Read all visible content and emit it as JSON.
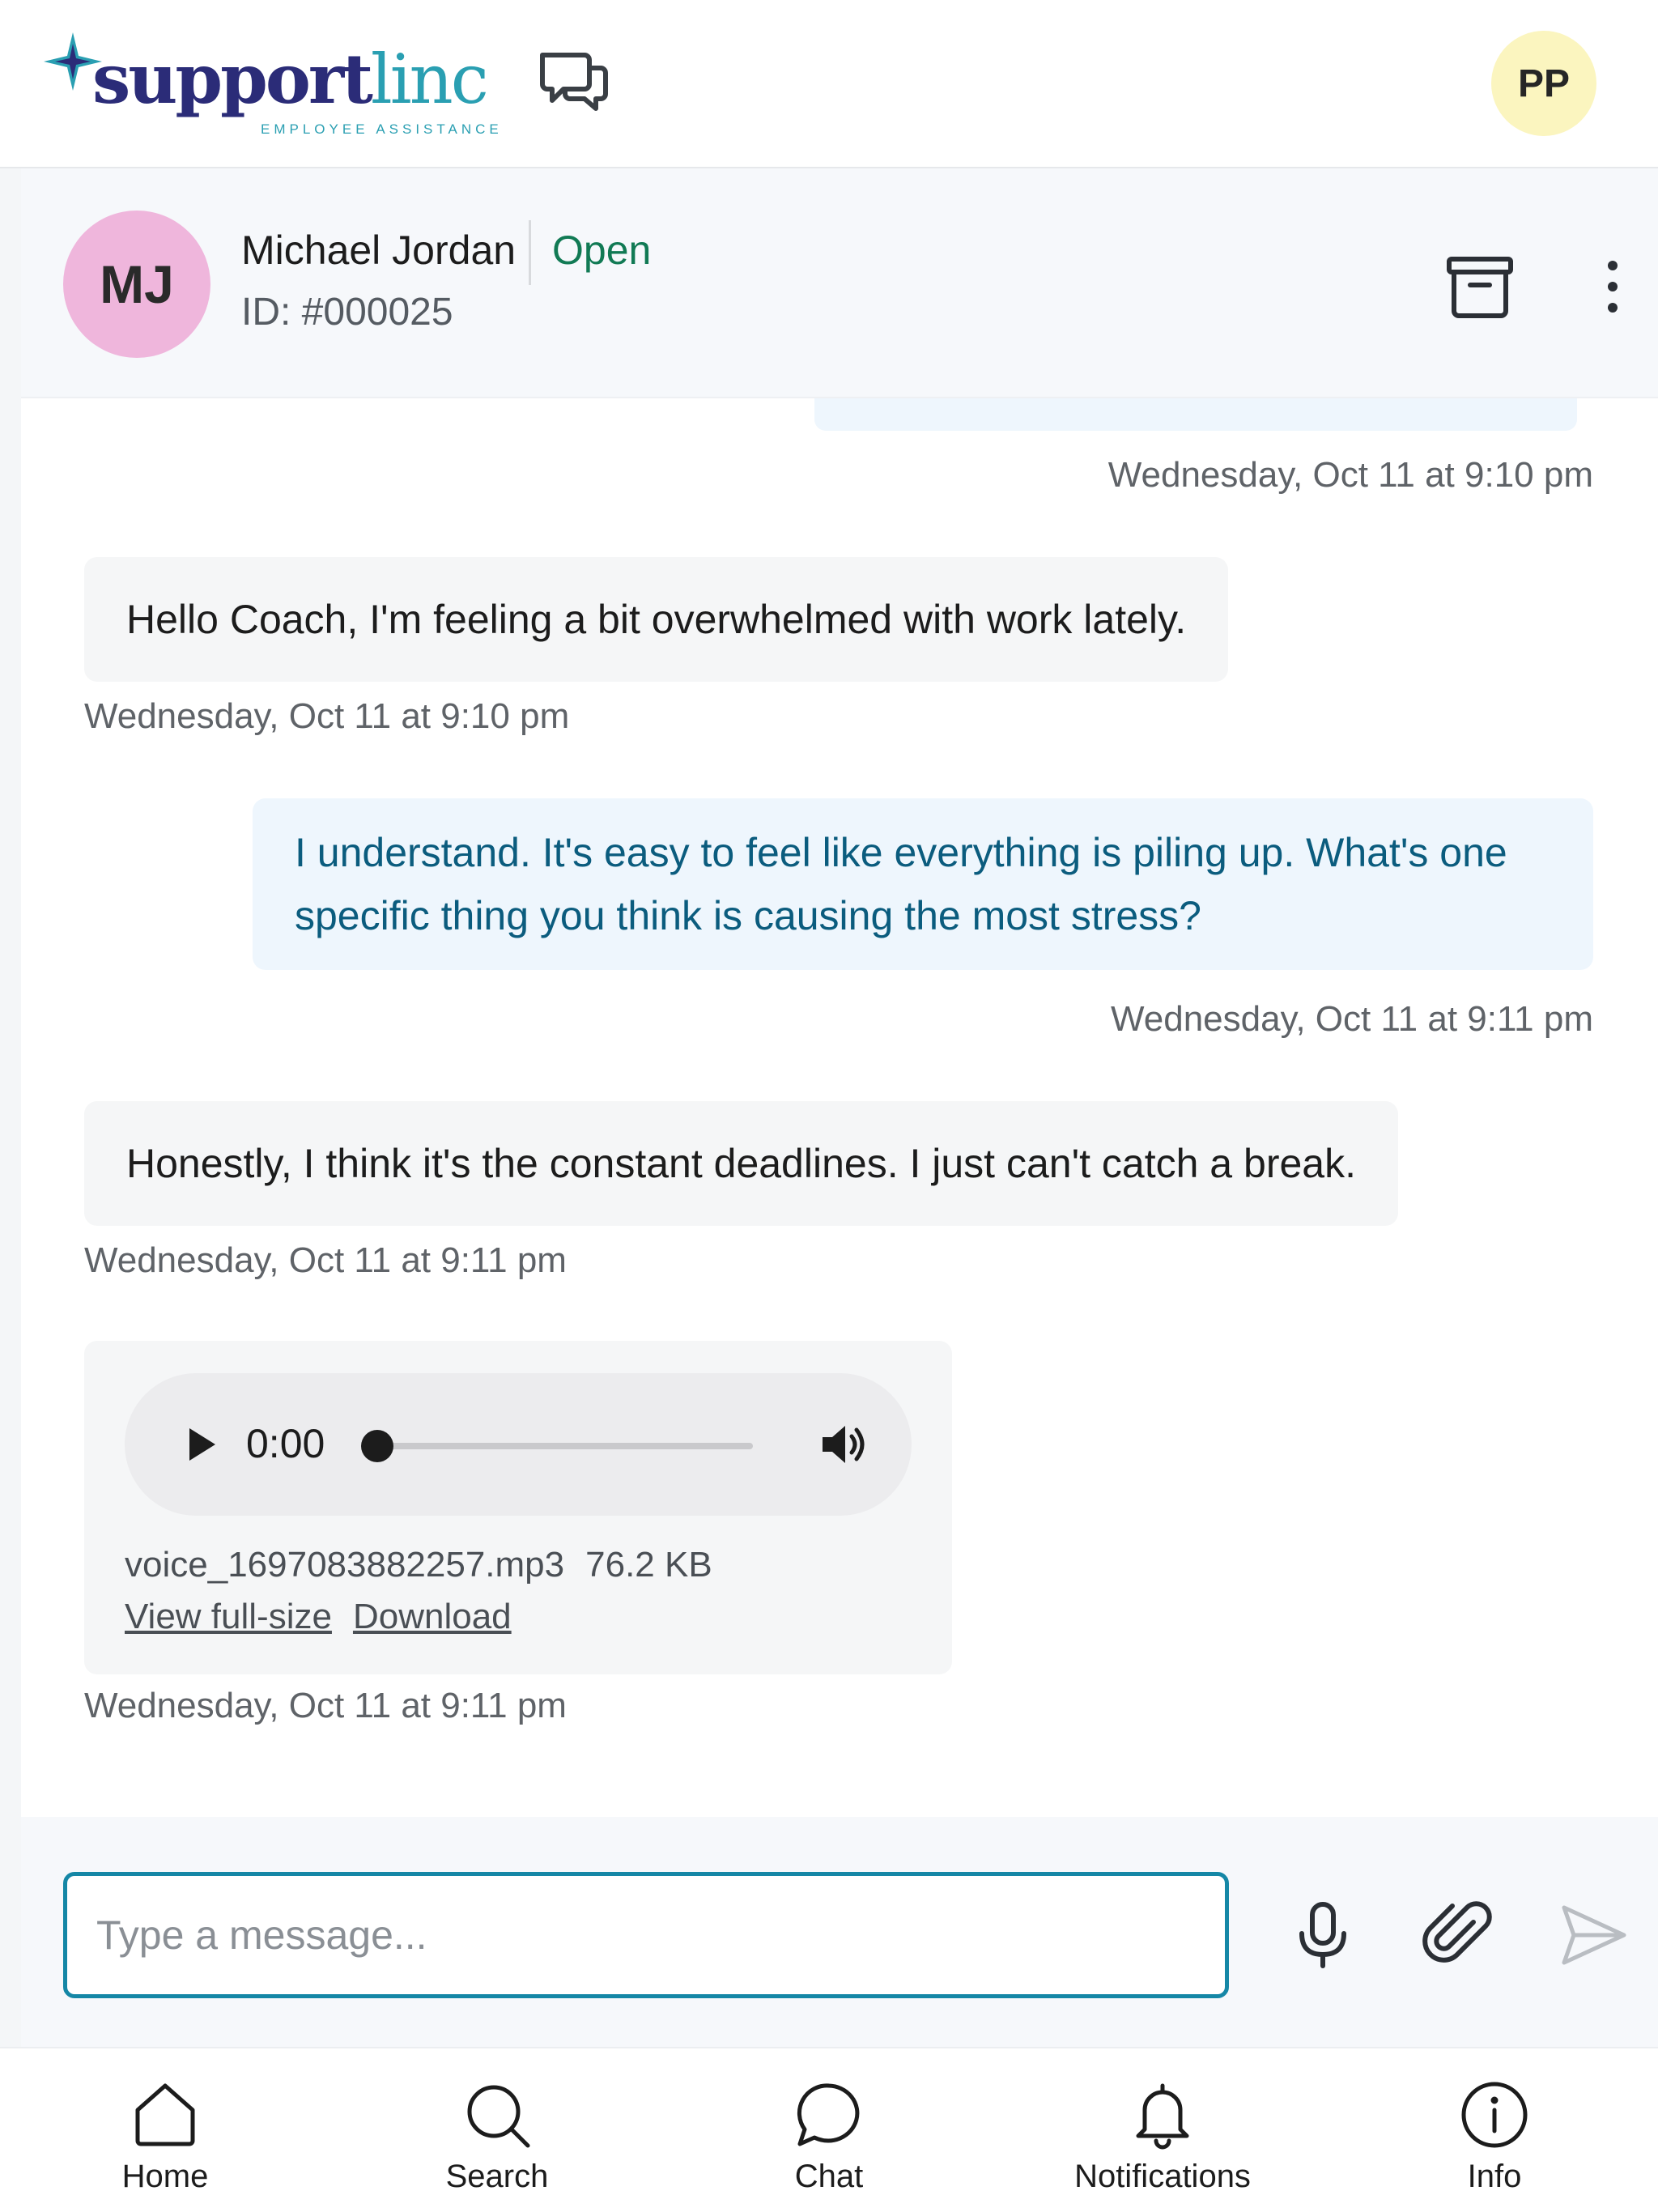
{
  "app": {
    "logo_main": "support",
    "logo_accent": "linc",
    "logo_tagline": "EMPLOYEE ASSISTANCE",
    "brand_colors": {
      "navy": "#2b2c78",
      "teal": "#2a9fb2"
    },
    "user_initials": "PP"
  },
  "conversation": {
    "contact_initials": "MJ",
    "contact_name": "Michael Jordan",
    "status": "Open",
    "status_color": "#117a54",
    "contact_id": "ID: #000025"
  },
  "messages": [
    {
      "direction": "outgoing",
      "text": "",
      "timestamp": "Wednesday, Oct 11 at 9:10 pm"
    },
    {
      "direction": "incoming",
      "text": "Hello Coach, I'm feeling a bit overwhelmed with work lately.",
      "timestamp": "Wednesday, Oct 11 at 9:10 pm"
    },
    {
      "direction": "outgoing",
      "text": "I understand. It's easy to feel like everything is piling up. What's one specific thing you think is causing the most stress?",
      "timestamp": "Wednesday, Oct 11 at 9:11 pm"
    },
    {
      "direction": "incoming",
      "text": "Honestly, I think it's the constant deadlines. I just can't catch a break.",
      "timestamp": "Wednesday, Oct 11 at 9:11 pm"
    },
    {
      "direction": "incoming",
      "type": "audio",
      "audio": {
        "current_time": "0:00",
        "progress": 0,
        "file_name": "voice_1697083882257.mp3",
        "file_size": "76.2 KB",
        "view_label": "View full-size",
        "download_label": "Download"
      },
      "timestamp": "Wednesday, Oct 11 at 9:11 pm"
    }
  ],
  "composer": {
    "placeholder": "Type a message...",
    "value": ""
  },
  "nav": {
    "items": [
      {
        "label": "Home",
        "icon": "home-icon"
      },
      {
        "label": "Search",
        "icon": "search-icon"
      },
      {
        "label": "Chat",
        "icon": "chat-icon"
      },
      {
        "label": "Notifications",
        "icon": "bell-icon"
      },
      {
        "label": "Info",
        "icon": "info-icon"
      }
    ]
  }
}
